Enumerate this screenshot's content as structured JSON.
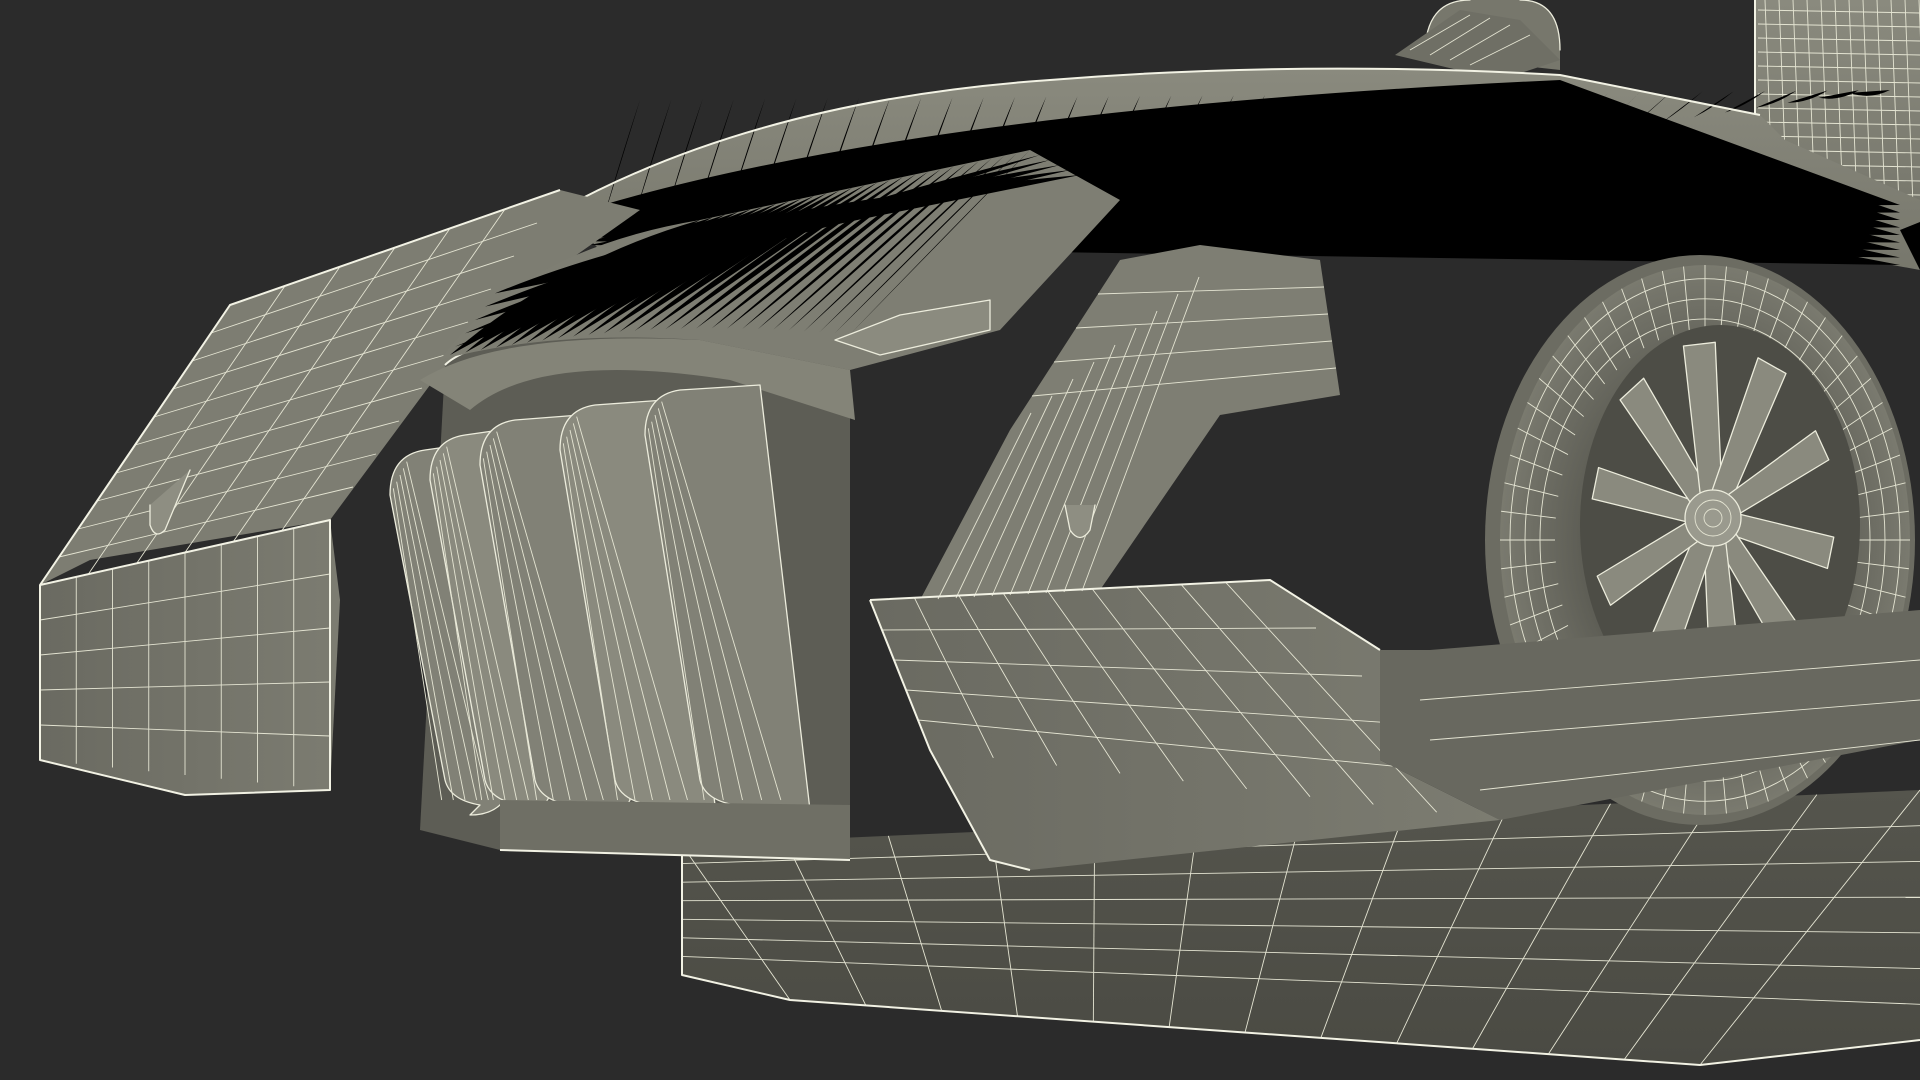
{
  "scene": {
    "subject": "wireframe-vehicle-front",
    "colors": {
      "background": "#2b2b2b",
      "surface_light": "#86867a",
      "surface_mid": "#76766b",
      "surface_dark": "#5f5f56",
      "surface_shadow": "#4e4e47",
      "wire": "#ececdc"
    }
  }
}
